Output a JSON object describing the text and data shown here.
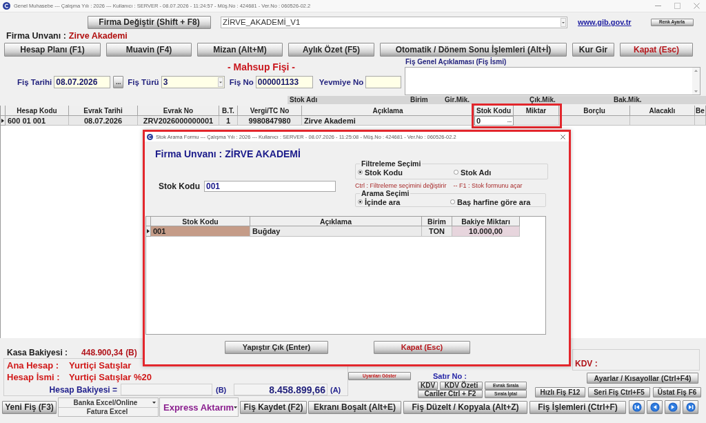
{
  "window": {
    "title": "Genel Muhasebe --- Çalışma Yılı : 2026 --- Kullanıcı : SERVER - 08.07.2026 - 11:24:57 - Müş.No : 424681 - Ver.No : 060526-02.2"
  },
  "header": {
    "change_company_button": "Firma Değiştir (Shift + F8)",
    "company_select": "ZİRVE_AKADEMİ_V1",
    "link": "www.gib.gov.tr",
    "color_button": "Renk Ayarla"
  },
  "company": {
    "label": "Firma Unvanı :",
    "value": "Zirve Akademi"
  },
  "toolbar": [
    {
      "label": "Hesap Planı (F1)",
      "kind": "normal"
    },
    {
      "label": "Muavin (F4)",
      "kind": "normal"
    },
    {
      "label": "Mizan (Alt+M)",
      "kind": "normal"
    },
    {
      "label": "Aylık Özet (F5)",
      "kind": "normal"
    },
    {
      "label": "Otomatik / Dönem Sonu İşlemleri (Alt+İ)",
      "kind": "normal"
    },
    {
      "label": "Kur Gir",
      "kind": "normal"
    },
    {
      "label": "Kapat (Esc)",
      "kind": "danger"
    }
  ],
  "voucher": {
    "title": "- Mahsup Fişi -",
    "fields": [
      {
        "label": "Fiş Tarihi",
        "value": "08.07.2026",
        "kind": "picker",
        "button": "..."
      },
      {
        "label": "Fiş Türü",
        "value": "3",
        "kind": "select"
      },
      {
        "label": "Fiş No",
        "value": "000001133",
        "kind": "text"
      },
      {
        "label": "Yevmiye No",
        "kind": "text"
      }
    ],
    "description_label": "Fiş Genel Açıklaması (Fiş İsmi)"
  },
  "stock_columns": [
    "Stok Adı",
    "Birim",
    "Gir.Mik.",
    "Çık.Mik.",
    "Bak.Mik."
  ],
  "table": {
    "columns": [
      "Hesap Kodu",
      "Evrak Tarihi",
      "Evrak No",
      "B.T.",
      "Vergi/TC No",
      "Açıklama",
      "Stok Kodu",
      "Miktar",
      "Borçlu",
      "Alacaklı",
      "Be"
    ],
    "rows": [
      {
        "selected": true,
        "cells": [
          "600 01 001",
          "08.07.2026",
          "ZRV2026000000001",
          "1",
          "9980847980",
          "Zirve Akademi",
          "0"
        ],
        "lookup_button": "..."
      }
    ]
  },
  "highlights": {
    "stock_columns": true,
    "dialog": true
  },
  "totals": {
    "cash_label": "Kasa Bakiyesi :",
    "cash_value": "448.900,34",
    "cash_suffix": "(B)",
    "main_account": {
      "label": "Ana Hesap :",
      "value": "Yurtiçi Satışlar"
    },
    "account_name": {
      "label": "Hesap İsmi :",
      "value": "Yurtiçi Satışlar %20"
    },
    "balance": {
      "label": "Hesap Bakiyesi =",
      "b_suffix": "(B)",
      "a_value": "8.458.899,66",
      "a_suffix": "(A)"
    },
    "vat_label": "KDV :",
    "warnings_button": "Uyarıları Göster",
    "row_no_label": "Satır No :",
    "row_buttons": [
      [
        {
          "label": "KDV",
          "kind": "normal"
        },
        {
          "label": "KDV Özeti",
          "kind": "normal"
        },
        {
          "label": "Evrak Sırala",
          "kind": "small"
        }
      ],
      [
        {
          "label": "Cariler Ctrl + F2",
          "kind": "normal"
        },
        {
          "label": "Sırala İptal",
          "kind": "small"
        }
      ]
    ],
    "settings_button": "Ayarlar / Kısayollar (Ctrl+F4)",
    "quick_buttons": [
      "Hızlı Fiş F12",
      "Seri Fiş Ctrl+F5",
      "Üstat Fiş F6"
    ]
  },
  "bottom_bar": [
    {
      "kind": "button",
      "label": "Yeni Fiş (F3)"
    },
    {
      "kind": "stack",
      "items": [
        {
          "label": "Banka Excel/Online",
          "dropdown": true
        },
        {
          "label": "Fatura Excel",
          "dropdown": false
        }
      ]
    },
    {
      "kind": "dropdown",
      "label": "Express Aktarım"
    },
    {
      "kind": "button",
      "label": "Fiş Kaydet (F2)"
    },
    {
      "kind": "button",
      "label": "Ekranı Boşalt (Alt+E)"
    },
    {
      "kind": "button",
      "label": "Fiş Düzelt / Kopyala (Alt+Z)"
    },
    {
      "kind": "button",
      "label": "Fiş İşlemleri (Ctrl+F)"
    },
    {
      "kind": "first"
    },
    {
      "kind": "previous"
    },
    {
      "kind": "next"
    },
    {
      "kind": "last"
    }
  ],
  "dialog": {
    "title": "Stok Arama Formu --- Çalışma Yılı : 2026 --- Kullanıcı : SERVER - 08.07.2026 - 11:25:08 - Müş.No : 424681 - Ver.No : 060526-02.2",
    "company": {
      "label": "Firma Unvanı :",
      "value": "ZİRVE AKADEMİ"
    },
    "search_field": {
      "label": "Stok Kodu",
      "value": "001"
    },
    "filter": {
      "legend": "Filtreleme Seçimi",
      "options": [
        {
          "label": "Stok Kodu",
          "selected": true
        },
        {
          "label": "Stok Adı",
          "selected": false
        }
      ]
    },
    "hints": [
      "Ctrl : Filtreleme seçimini değiştirir",
      "-- F1 : Stok formunu açar"
    ],
    "search_mode": {
      "legend": "Arama Seçimi",
      "options": [
        {
          "label": "İçinde ara",
          "selected": true
        },
        {
          "label": "Baş harfine göre ara",
          "selected": false
        }
      ]
    },
    "table": {
      "columns": [
        "Stok Kodu",
        "Açıklama",
        "Birim",
        "Bakiye Miktarı"
      ],
      "rows": [
        {
          "selected": true,
          "cells": [
            "001",
            "Buğday",
            "TON",
            "10.000,00"
          ]
        }
      ]
    },
    "buttons": [
      {
        "label": "Yapıştır Çık (Enter)",
        "kind": "normal"
      },
      {
        "label": "Kapat (Esc)",
        "kind": "danger"
      }
    ]
  }
}
